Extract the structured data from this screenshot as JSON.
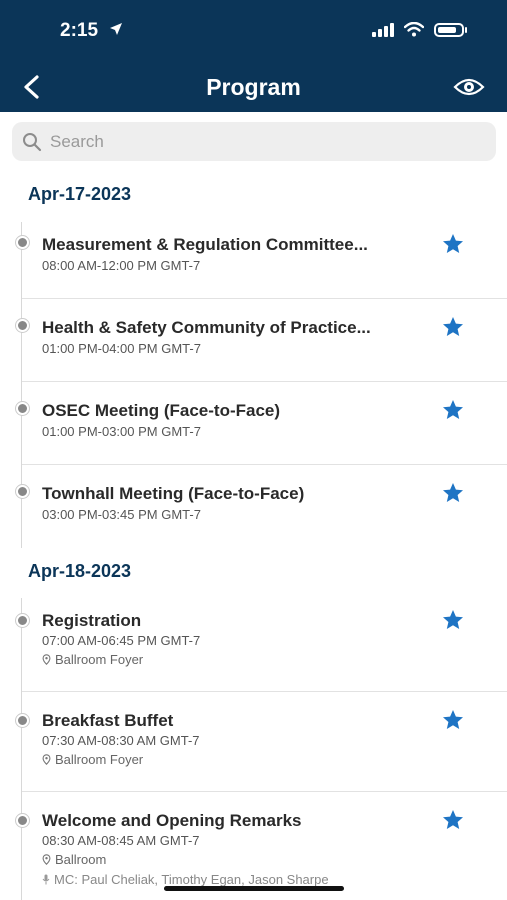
{
  "status": {
    "time": "2:15"
  },
  "nav": {
    "title": "Program"
  },
  "search": {
    "placeholder": "Search"
  },
  "colors": {
    "header_bg": "#0b3558",
    "star": "#1e74c4",
    "date": "#0b3558"
  },
  "days": [
    {
      "date": "Apr-17-2023",
      "sessions": [
        {
          "title": "Measurement & Regulation Committee...",
          "time": "08:00 AM-12:00 PM GMT-7",
          "starred": true
        },
        {
          "title": "Health & Safety Community of Practice...",
          "time": "01:00 PM-04:00 PM GMT-7",
          "starred": true
        },
        {
          "title": "OSEC Meeting (Face-to-Face)",
          "time": "01:00 PM-03:00 PM GMT-7",
          "starred": true
        },
        {
          "title": "Townhall Meeting (Face-to-Face)",
          "time": "03:00 PM-03:45 PM GMT-7",
          "starred": true
        }
      ]
    },
    {
      "date": "Apr-18-2023",
      "sessions": [
        {
          "title": "Registration",
          "time": "07:00 AM-06:45 PM GMT-7",
          "location": "Ballroom Foyer",
          "starred": true
        },
        {
          "title": "Breakfast Buffet",
          "time": "07:30 AM-08:30 AM GMT-7",
          "location": "Ballroom Foyer",
          "starred": true
        },
        {
          "title": "Welcome and Opening Remarks",
          "time": "08:30 AM-08:45 AM GMT-7",
          "location": "Ballroom",
          "speakers": "MC: Paul Cheliak, Timothy Egan, Jason Sharpe",
          "starred": true
        }
      ]
    }
  ]
}
